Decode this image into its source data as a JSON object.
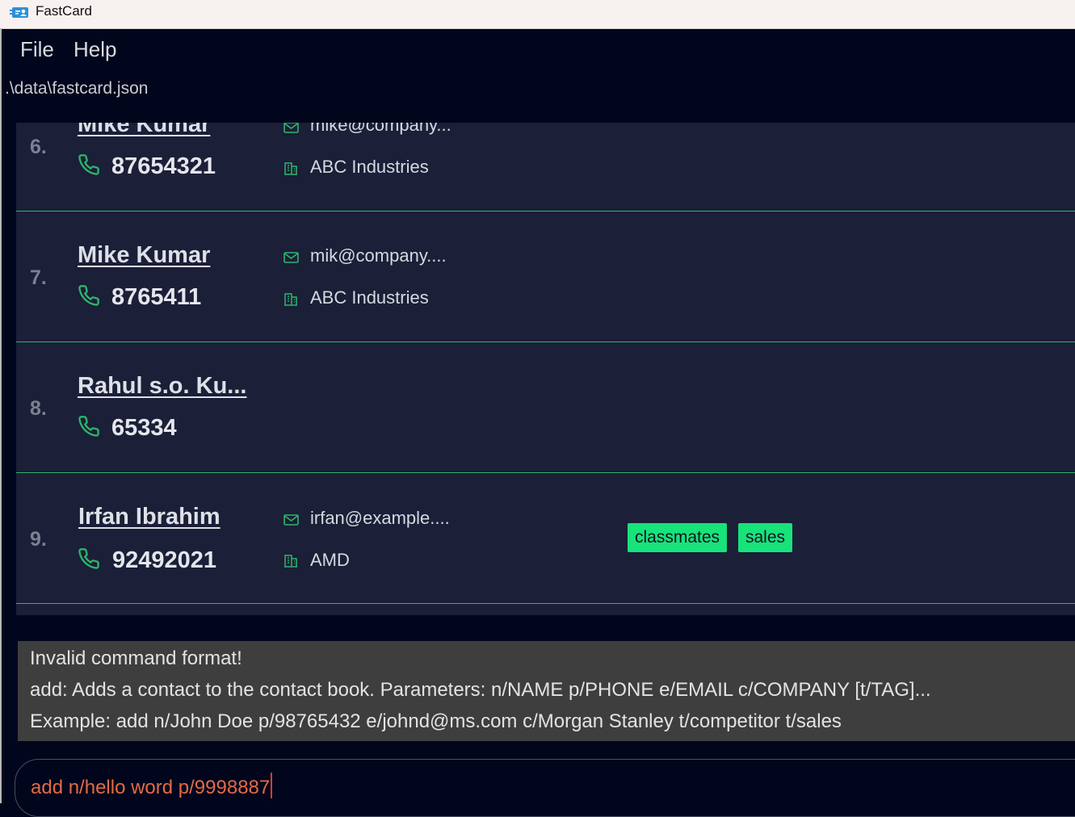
{
  "window": {
    "title": "FastCard",
    "icon": "contact-card-icon"
  },
  "menu": {
    "items": [
      "File",
      "Help"
    ]
  },
  "status": {
    "file_path": ".\\data\\fastcard.json"
  },
  "colors": {
    "background": "#02061c",
    "list_background": "#1b1f38",
    "accent": "#2eb56a",
    "tag": "#18e27a",
    "result_background": "#3e3e3e",
    "command_text": "#e06b45"
  },
  "contacts": [
    {
      "index": "6.",
      "name": "Mike Kumar",
      "phone": "87654321",
      "email": "mike@company...",
      "company": "ABC Industries",
      "tags": []
    },
    {
      "index": "7.",
      "name": "Mike Kumar",
      "phone": "8765411",
      "email": "mik@company....",
      "company": "ABC Industries",
      "tags": []
    },
    {
      "index": "8.",
      "name": "Rahul s.o. Ku...",
      "phone": "65334",
      "email": "",
      "company": "",
      "tags": []
    },
    {
      "index": "9.",
      "name": "Irfan Ibrahim",
      "phone": "92492021",
      "email": "irfan@example....",
      "company": "AMD",
      "tags": [
        "classmates",
        "sales"
      ]
    }
  ],
  "result": {
    "lines": [
      "Invalid command format!",
      "add: Adds a contact to the contact book. Parameters: n/NAME p/PHONE e/EMAIL c/COMPANY [t/TAG]...",
      "Example: add n/John Doe p/98765432 e/johnd@ms.com c/Morgan Stanley t/competitor t/sales"
    ]
  },
  "command": {
    "value": "add n/hello word p/9998887"
  }
}
